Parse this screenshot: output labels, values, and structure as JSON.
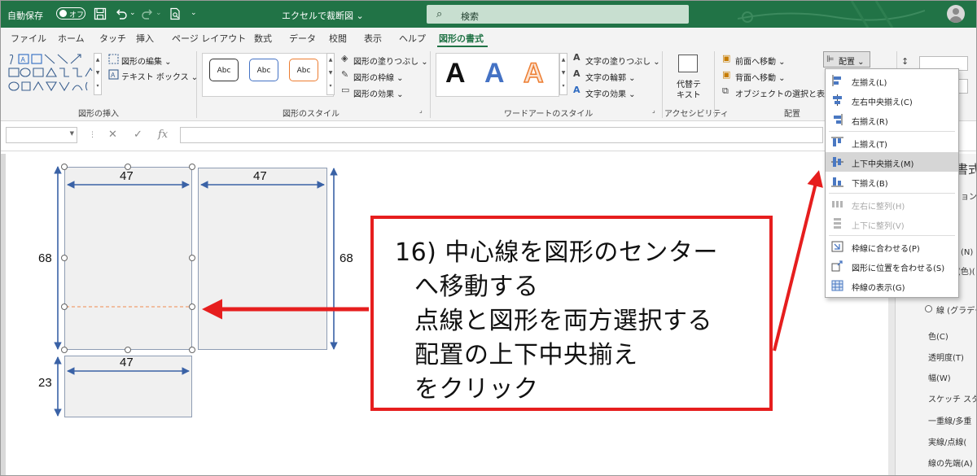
{
  "titlebar": {
    "autosave_label": "自動保存",
    "autosave_state": "オフ",
    "document_title": "エクセルで裁断図",
    "search_placeholder": "検索"
  },
  "tabs": [
    "ファイル",
    "ホーム",
    "タッチ",
    "挿入",
    "ページ レイアウト",
    "数式",
    "データ",
    "校閲",
    "表示",
    "ヘルプ",
    "図形の書式"
  ],
  "active_tab": "図形の書式",
  "ribbon": {
    "insert_shapes": {
      "label": "図形の挿入",
      "edit_shape": "図形の編集",
      "text_box": "テキスト ボックス"
    },
    "shape_styles": {
      "label": "図形のスタイル",
      "samples": [
        "Abc",
        "Abc",
        "Abc"
      ],
      "fill": "図形の塗りつぶし",
      "outline": "図形の枠線",
      "effects": "図形の効果"
    },
    "wordart": {
      "label": "ワードアートのスタイル",
      "letters": [
        "A",
        "A",
        "A"
      ],
      "text_fill": "文字の塗りつぶし",
      "text_outline": "文字の輪郭",
      "text_effects": "文字の効果"
    },
    "accessibility": {
      "label": "アクセシビリティ",
      "alt_text_line1": "代替テ",
      "alt_text_line2": "キスト"
    },
    "arrange": {
      "label": "配置",
      "bring_forward": "前面へ移動",
      "send_backward": "背面へ移動",
      "selection_pane": "オブジェクトの選択と表示",
      "align_button": "配置"
    }
  },
  "formula_bar": {
    "cancel": "✕",
    "enter": "✓",
    "fx": "fx"
  },
  "align_menu": {
    "items": [
      {
        "label": "左揃え(L)",
        "enabled": true,
        "highlighted": false
      },
      {
        "label": "左右中央揃え(C)",
        "enabled": true,
        "highlighted": false
      },
      {
        "label": "右揃え(R)",
        "enabled": true,
        "highlighted": false
      },
      {
        "label": "上揃え(T)",
        "enabled": true,
        "highlighted": false
      },
      {
        "label": "上下中央揃え(M)",
        "enabled": true,
        "highlighted": true
      },
      {
        "label": "下揃え(B)",
        "enabled": true,
        "highlighted": false
      },
      {
        "label": "左右に整列(H)",
        "enabled": false,
        "highlighted": false
      },
      {
        "label": "上下に整列(V)",
        "enabled": false,
        "highlighted": false
      },
      {
        "label": "枠線に合わせる(P)",
        "enabled": true,
        "highlighted": false
      },
      {
        "label": "図形に位置を合わせる(S)",
        "enabled": true,
        "highlighted": false
      },
      {
        "label": "枠線の表示(G)",
        "enabled": true,
        "highlighted": false
      }
    ]
  },
  "format_pane": {
    "title_fragment": "書式",
    "section_fragment": "ョン",
    "option_n": "(N)",
    "option_color_fragment": "(色)(",
    "line_option": "線 (グラデー",
    "rows": [
      "色(C)",
      "透明度(T)",
      "幅(W)",
      "スケッチ スタイ",
      "一重線/多重",
      "実線/点線(",
      "線の先端(A)"
    ]
  },
  "drawing": {
    "dims": [
      "47",
      "47",
      "68",
      "68",
      "47",
      "23"
    ]
  },
  "callout": {
    "lines": [
      "16) 中心線を図形のセンター",
      "へ移動する",
      "点線と図形を両方選択する",
      "配置の上下中央揃え",
      "をクリック"
    ]
  },
  "colors": {
    "title_bar": "#217346",
    "accent_red": "#e61e1e",
    "dimension_blue": "#3a62a6",
    "dashed_orange": "#f0a070",
    "menu_highlight": "#d6d6d6"
  }
}
